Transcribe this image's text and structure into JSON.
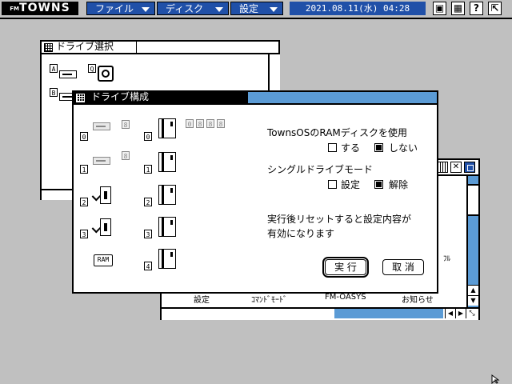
{
  "menubar": {
    "logo_prefix": "FM",
    "logo": "TOWNS",
    "menus": [
      {
        "label": "ファイル"
      },
      {
        "label": "ディスク"
      },
      {
        "label": "設定"
      }
    ],
    "datetime": "2021.08.11(水) 04:28",
    "icons": [
      "save-icon",
      "grid-icon",
      "help-icon",
      "exit-icon"
    ],
    "icon_glyphs": [
      "▣",
      "▦",
      "?",
      "⇱"
    ]
  },
  "drive_select_window": {
    "title": "ドライブ選択",
    "drive_labels": [
      "A",
      "Q",
      "B"
    ]
  },
  "back_window": {
    "status_items": [
      "設定",
      "ｺﾏﾝﾄﾞﾓｰﾄﾞ",
      "FM-OASYS",
      "お知らせ"
    ],
    "side_text": "ﾌﾙ"
  },
  "drive_config_dialog": {
    "title": "ドライブ構成",
    "left_numbers": [
      "0",
      "1",
      "2",
      "3"
    ],
    "left_top_grey": [
      "8",
      "8"
    ],
    "right_numbers": [
      "0",
      "1",
      "2",
      "3",
      "4"
    ],
    "top_grey_boxes": [
      "0",
      "8",
      "8",
      "8"
    ],
    "ram_label": "RAM",
    "ramdisk_heading": "TownsOSのRAMディスクを使用",
    "ramdisk_options": [
      {
        "label": "する",
        "checked": false
      },
      {
        "label": "しない",
        "checked": true
      }
    ],
    "single_heading": "シングルドライブモード",
    "single_options": [
      {
        "label": "設定",
        "checked": false
      },
      {
        "label": "解除",
        "checked": true
      }
    ],
    "note_line1": "実行後リセットすると設定内容が",
    "note_line2": "有効になります",
    "ok_label": "実 行",
    "cancel_label": "取 消"
  },
  "colors": {
    "accent": "#2050a8",
    "scroll_blue": "#5b9bd5",
    "desktop": "#c0c0c0"
  }
}
